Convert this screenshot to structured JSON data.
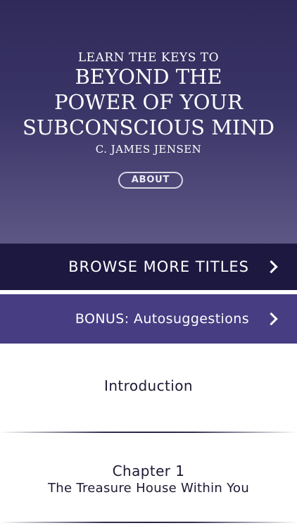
{
  "header": {
    "eyebrow": "LEARN THE KEYS TO",
    "title_lines": [
      "BEYOND THE",
      "POWER OF YOUR",
      "SUBCONSCIOUS MIND"
    ],
    "author": "C. JAMES JENSEN",
    "about_label": "ABOUT"
  },
  "menu": {
    "browse_label": "BROWSE MORE TITLES",
    "bonus_label": "BONUS: Autosuggestions"
  },
  "chapters": [
    {
      "title": "Introduction"
    },
    {
      "title": "Chapter 1",
      "subtitle": "The Treasure House Within You"
    }
  ],
  "icons": {
    "browse_arrow": "chevron-right-icon",
    "bonus_arrow": "chevron-right-icon"
  },
  "colors": {
    "header_top": "#2f2a59",
    "header_bottom": "#5c5784",
    "browse_bg": "#1d1840",
    "bonus_bg": "#463d82",
    "chapter_text": "#1c1a33"
  }
}
